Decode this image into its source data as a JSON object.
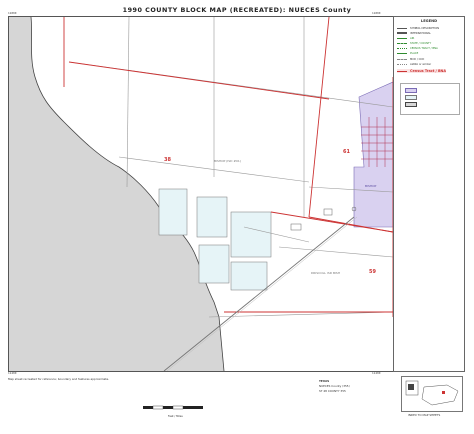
{
  "title": "1990 COUNTY BLOCK MAP (RECREATED): NUECES County",
  "corners": {
    "top_left": "11890",
    "top_right": "11890",
    "bottom_left": "11490",
    "bottom_right": "11490"
  },
  "legend": {
    "heading": "LEGEND",
    "items": [
      {
        "label": "SYMBOL DESCRIPTION",
        "color": "#555555"
      },
      {
        "label": "INTERNATIONAL",
        "color": "#555555"
      },
      {
        "label": "AIR",
        "color": "#2e8b2e"
      },
      {
        "label": "STATE / COUNTY",
        "color": "#2e8b2e"
      },
      {
        "label": "CENSUS TRACT / BNA",
        "color": "#2e8b2e"
      },
      {
        "label": "PLACE",
        "color": "#2e8b2e"
      },
      {
        "label": "MCD / CCD",
        "color": "#888888"
      },
      {
        "label": "AIANA or similar",
        "color": "#888888"
      },
      {
        "label": "Census Tract / BNA",
        "color": "#cc3333"
      }
    ],
    "highlight": "Census Tract / BNA"
  },
  "map_labels": {
    "tract_a": "38",
    "tract_b": "61",
    "tract_c": "59",
    "place_name": "BISHOP (ISD #01)",
    "area_name": "NUECES COUNTY",
    "town_label": "BISHOP",
    "area_name_2": "DRISCOLL ISD BISH"
  },
  "footer": {
    "sheet": "NUECES County (355)",
    "state": "TEXAS",
    "sheet_id": "ST 48 COUNTY 355",
    "disclaimer": "Map sheet recreated for reference; boundary and features approximate.",
    "scale_note": "Feet / Miles",
    "inset_caption": "INDEX TO MAP SHEETS"
  }
}
